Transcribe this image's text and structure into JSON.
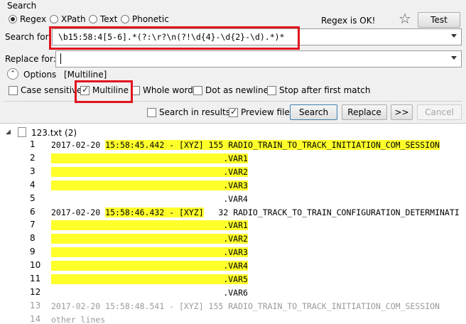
{
  "search_group": {
    "title": "Search",
    "modes": [
      {
        "label": "Regex",
        "selected": true
      },
      {
        "label": "XPath",
        "selected": false
      },
      {
        "label": "Text",
        "selected": false
      },
      {
        "label": "Phonetic",
        "selected": false
      }
    ],
    "status": "Regex is OK!",
    "test_label": "Test",
    "search_for_label": "Search for:",
    "search_value": "\\b15:58:4[5-6].*(?:\\r?\\n(?!\\d{4}-\\d{2}-\\d).*)*",
    "replace_for_label": "Replace for:",
    "replace_value": "",
    "options_label": "Options",
    "options_summary": "[Multiline]",
    "checkboxes": [
      {
        "label": "Case sensitive",
        "checked": false
      },
      {
        "label": "Multiline",
        "checked": true
      },
      {
        "label": "Whole word",
        "checked": false
      },
      {
        "label": "Dot as newline",
        "checked": false
      },
      {
        "label": "Stop after first match",
        "checked": false
      }
    ]
  },
  "actions": {
    "search_in_results_label": "Search in results",
    "search_in_results_checked": false,
    "preview_file_label": "Preview file",
    "preview_file_checked": true,
    "search_button": "Search",
    "replace_button": "Replace",
    "more_button": ">>",
    "cancel_button": "Cancel"
  },
  "results": {
    "file_label": "123.txt (2)",
    "lines": [
      {
        "num": "1",
        "pre": "2017-02-20 ",
        "hl": "15:58:45.442 - [XYZ] 155 RADIO_TRAIN_TO_TRACK_INITIATION_COM_SESSION",
        "post": "",
        "gray": false
      },
      {
        "num": "2",
        "pre": "",
        "hl": "                                   .VAR1",
        "post": "",
        "gray": false
      },
      {
        "num": "3",
        "pre": "",
        "hl": "                                   .VAR2",
        "post": "",
        "gray": false
      },
      {
        "num": "4",
        "pre": "",
        "hl": "                                   .VAR3",
        "post": "",
        "gray": false
      },
      {
        "num": "5",
        "pre": "                                   .VAR4",
        "hl": "",
        "post": "",
        "gray": false
      },
      {
        "num": "6",
        "pre": "2017-02-20 ",
        "hl": "15:58:46.432 - [XYZ]",
        "post": "   32 RADIO_TRACK_TO_TRAIN_CONFIGURATION_DETERMINATI",
        "gray": false
      },
      {
        "num": "7",
        "pre": "",
        "hl": "                                   .VAR1",
        "post": "",
        "gray": false
      },
      {
        "num": "8",
        "pre": "",
        "hl": "                                   .VAR2",
        "post": "",
        "gray": false
      },
      {
        "num": "9",
        "pre": "",
        "hl": "                                   .VAR3",
        "post": "",
        "gray": false
      },
      {
        "num": "10",
        "pre": "",
        "hl": "                                   .VAR4",
        "post": "",
        "gray": false
      },
      {
        "num": "11",
        "pre": "",
        "hl": "                                   .VAR5",
        "post": "",
        "gray": false
      },
      {
        "num": "12",
        "pre": "                                   .VAR6",
        "hl": "",
        "post": "",
        "gray": false
      },
      {
        "num": "13",
        "pre": "2017-02-20 15:58:48.541 - [XYZ] 155 RADIO_TRAIN_TO_TRACK_INITIATION_COM_SESSION",
        "hl": "",
        "post": "",
        "gray": true
      },
      {
        "num": "14",
        "pre": "other lines",
        "hl": "",
        "post": "",
        "gray": true
      }
    ]
  },
  "colors": {
    "highlight": "#ffff2a",
    "annotation_box": "#e0141e"
  }
}
